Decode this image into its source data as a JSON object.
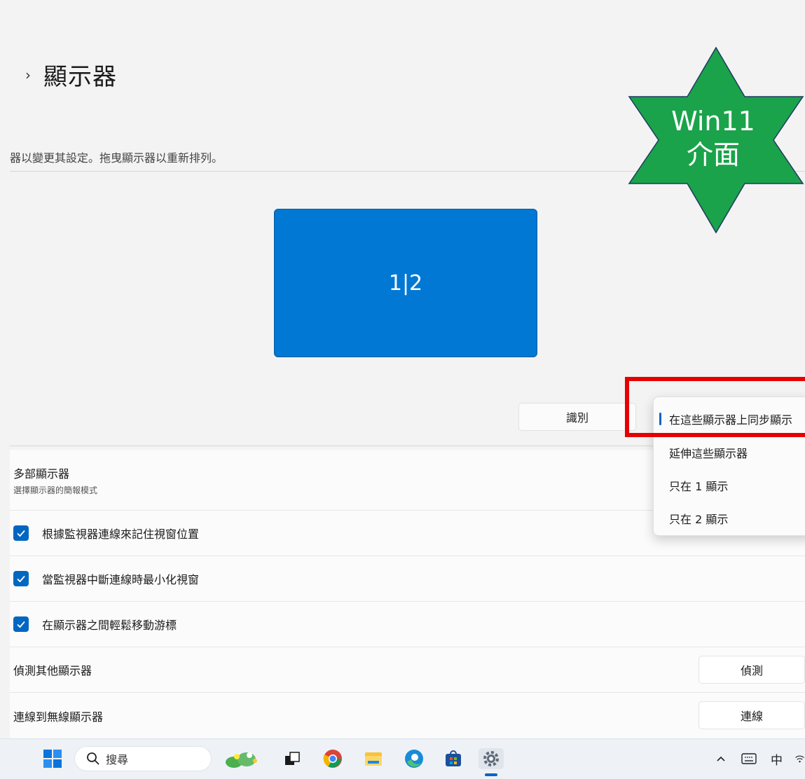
{
  "header": {
    "title": "顯示器",
    "description": "器以變更其設定。拖曳顯示器以重新排列。"
  },
  "arrange": {
    "monitor_label": "1|2",
    "identify_label": "識別"
  },
  "dropdown": {
    "options": [
      "在這些顯示器上同步顯示",
      "延伸這些顯示器",
      "只在 1 顯示",
      "只在 2 顯示"
    ],
    "selected_index": 0
  },
  "settings": {
    "multi_display": {
      "title": "多部顯示器",
      "subtitle": "選擇顯示器的簡報模式"
    },
    "remember_windows": {
      "label": "根據監視器連線來記住視窗位置",
      "checked": true
    },
    "minimize_windows": {
      "label": "當監視器中斷連線時最小化視窗",
      "checked": true
    },
    "ease_cursor": {
      "label": "在顯示器之間輕鬆移動游標",
      "checked": true
    },
    "detect": {
      "label": "偵測其他顯示器",
      "button": "偵測"
    },
    "wireless": {
      "label": "連線到無線顯示器",
      "button": "連線"
    }
  },
  "badge": {
    "line1": "Win11",
    "line2": "介面",
    "color": "#1aa34a"
  },
  "taskbar": {
    "search_placeholder": "搜尋",
    "ime": "中",
    "icons": [
      "windows-start-icon",
      "search-icon",
      "widgets-icon",
      "task-view-icon",
      "chrome-icon",
      "file-explorer-icon",
      "edge-icon",
      "store-icon",
      "settings-icon",
      "chevron-up-icon",
      "keyboard-icon",
      "wifi-icon"
    ]
  },
  "colors": {
    "accent": "#0067c0",
    "monitor": "#0078d4",
    "highlight": "#e60000"
  }
}
